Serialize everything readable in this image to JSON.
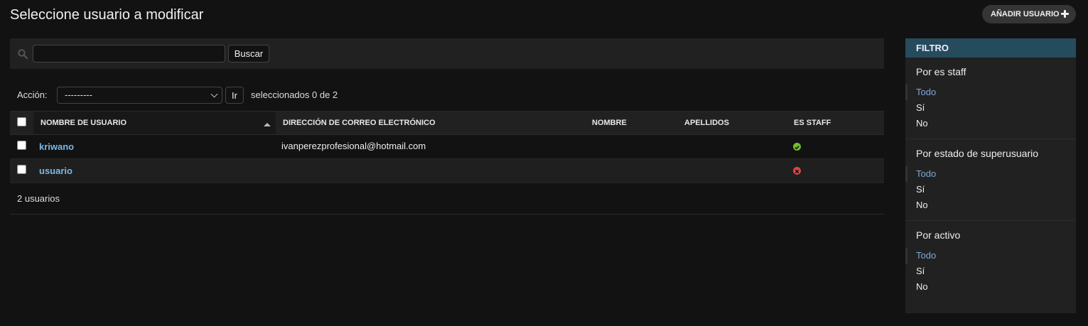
{
  "header": {
    "title": "Seleccione usuario a modificar",
    "add_button": "AÑADIR USUARIO"
  },
  "search": {
    "value": "",
    "placeholder": "",
    "button": "Buscar"
  },
  "actions": {
    "label": "Acción:",
    "selected": "---------",
    "go_button": "Ir",
    "counter": "seleccionados 0 de 2"
  },
  "table": {
    "columns": [
      "NOMBRE DE USUARIO",
      "DIRECCIÓN DE CORREO ELECTRÓNICO",
      "NOMBRE",
      "APELLIDOS",
      "ES STAFF"
    ],
    "sorted_column": "NOMBRE DE USUARIO",
    "sort_direction": "ascending",
    "rows": [
      {
        "username": "kriwano",
        "email": "ivanperezprofesional@hotmail.com",
        "first_name": "",
        "last_name": "",
        "is_staff": true,
        "staff_icon": "check-circle-icon"
      },
      {
        "username": "usuario",
        "email": "",
        "first_name": "",
        "last_name": "",
        "is_staff": false,
        "staff_icon": "x-circle-icon"
      }
    ],
    "count": "2 usuarios"
  },
  "filter": {
    "title": "FILTRO",
    "groups": [
      {
        "title": "Por es staff",
        "options": [
          "Todo",
          "Sí",
          "No"
        ],
        "selected": "Todo"
      },
      {
        "title": "Por estado de superusuario",
        "options": [
          "Todo",
          "Sí",
          "No"
        ],
        "selected": "Todo"
      },
      {
        "title": "Por activo",
        "options": [
          "Todo",
          "Sí",
          "No"
        ],
        "selected": "Todo"
      }
    ]
  },
  "colors": {
    "background": "#121212",
    "link": "#79b8e6",
    "filter_header": "#264b5d",
    "yes": "#70bf2b",
    "no": "#dd4646"
  }
}
